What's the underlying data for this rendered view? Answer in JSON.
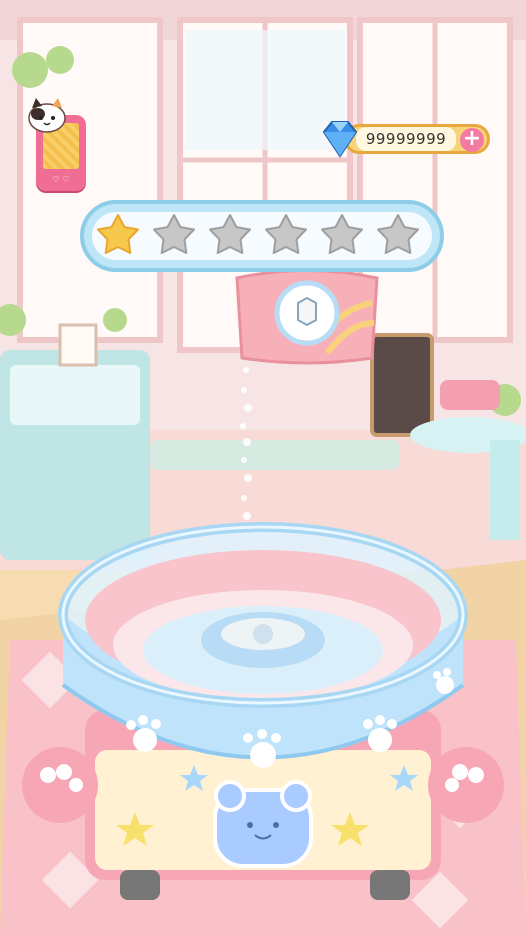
{
  "hud": {
    "gems_value": "99999999",
    "plus_label": "+",
    "phone_dots": "♡ ♡"
  },
  "stars": {
    "total": 6,
    "earned": 1,
    "earned_color": "#f6c84b",
    "empty_color": "#c7c7c7"
  },
  "icons": {
    "gem": "blue-diamond",
    "cat": "calico-cat",
    "star": "star",
    "bag": "sugar-bag",
    "machine": "cotton-candy-machine",
    "bear": "bear-face"
  },
  "colors": {
    "accent_pink": "#f37aa3",
    "bar_gold": "#f7d37a",
    "bowl_blue": "#bfe3fb"
  }
}
